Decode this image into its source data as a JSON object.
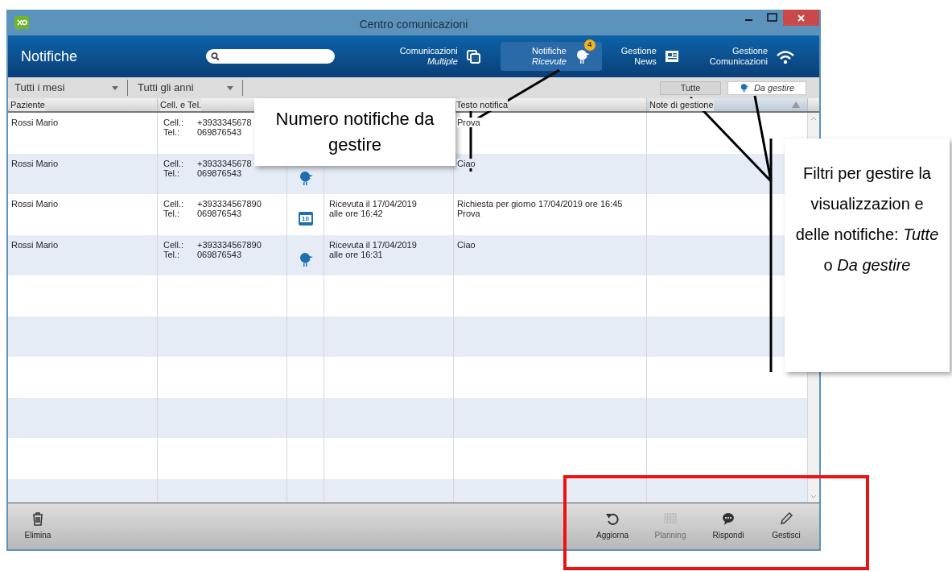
{
  "window": {
    "title": "Centro comunicazioni"
  },
  "header": {
    "title": "Notifiche",
    "nav": [
      {
        "line1": "Comunicazioni",
        "line2": "Multiple",
        "second_italic": true,
        "selected": false,
        "kind": "copies"
      },
      {
        "line1": "Notifiche",
        "line2": "Ricevute",
        "second_italic": true,
        "selected": true,
        "kind": "bird",
        "badge": "4"
      },
      {
        "line1": "Gestione",
        "line2": "News",
        "second_italic": false,
        "selected": false,
        "kind": "news"
      },
      {
        "line1": "Gestione",
        "line2": "Comunicazioni",
        "second_italic": false,
        "selected": false,
        "kind": "wifi"
      }
    ]
  },
  "filters": {
    "dropdowns": [
      "Tutti i mesi",
      "Tutti gli anni"
    ],
    "toggles": [
      {
        "label": "Tutte",
        "selected": false,
        "kind": "plain"
      },
      {
        "label": "Da gestire",
        "selected": true,
        "kind": "bird"
      }
    ]
  },
  "table": {
    "columns": [
      "Paziente",
      "Cell. e Tel.",
      "Testo notifica",
      "Note di gestione"
    ],
    "rows": [
      {
        "patient": "Rossi Mario",
        "cell_label": "Cell.:",
        "cell": "+3933345678",
        "tel_label": "Tel.:",
        "tel": "069876543",
        "date_lines": [],
        "text_lines": [
          "Prova"
        ]
      },
      {
        "patient": "Rossi Mario",
        "cell_label": "Cell.:",
        "cell": "+3933345678",
        "tel_label": "Tel.:",
        "tel": "069876543",
        "kind": "bird",
        "date_lines": [],
        "text_lines": [
          "Ciao"
        ]
      },
      {
        "patient": "Rossi Mario",
        "cell_label": "Cell.:",
        "cell": "+393334567890",
        "tel_label": "Tel.:",
        "tel": "069876543",
        "kind": "calendar",
        "icon_label": "10",
        "date_lines": [
          "Ricevuta il 17/04/2019",
          "alle ore 16:42"
        ],
        "text_lines": [
          "Richiesta per giorno 17/04/2019 ore 16:45",
          "Prova"
        ]
      },
      {
        "patient": "Rossi Mario",
        "cell_label": "Cell.:",
        "cell": "+393334567890",
        "tel_label": "Tel.:",
        "tel": "069876543",
        "kind": "bird",
        "date_lines": [
          "Ricevuta il 17/04/2019",
          "alle ore 16:31"
        ],
        "text_lines": [
          "Ciao"
        ]
      }
    ]
  },
  "toolbar": {
    "left": [
      {
        "label": "Elimina",
        "kind": "trash",
        "disabled": false
      }
    ],
    "right": [
      {
        "label": "Aggiorna",
        "kind": "refresh",
        "disabled": false
      },
      {
        "label": "Planning",
        "kind": "grid",
        "disabled": true
      },
      {
        "label": "Rispondi",
        "kind": "chat",
        "disabled": false
      },
      {
        "label": "Gestisci",
        "kind": "pencil",
        "disabled": false
      }
    ]
  },
  "callouts": [
    {
      "text": "Numero notifiche da gestire"
    },
    {
      "text": "Filtri per gestire la visualizzazion e delle notifiche: *Tutte* o *Da gestire*"
    }
  ]
}
